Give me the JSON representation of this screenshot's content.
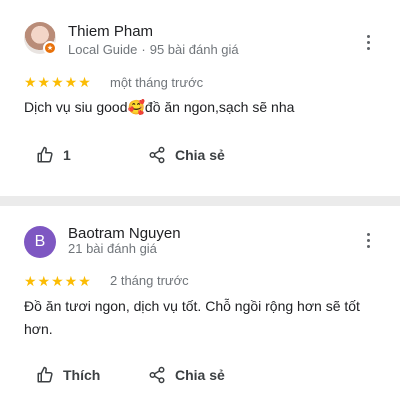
{
  "reviews": [
    {
      "name": "Thiem Pham",
      "role": "Local Guide",
      "review_count": "95 bài đánh giá",
      "stars": "★★★★★",
      "rating": 5,
      "time": "một tháng trước",
      "text": "Dịch vụ siu good🥰đồ ăn ngon,sạch sẽ nha",
      "like_label": "1",
      "share_label": "Chia sẻ"
    },
    {
      "name": "Baotram Nguyen",
      "avatar_letter": "B",
      "review_count": "21 bài đánh giá",
      "stars": "★★★★★",
      "rating": 5,
      "time": "2 tháng trước",
      "text": "Đồ ăn tươi ngon, dịch vụ tốt. Chỗ ngồi rộng hơn sẽ tốt hơn.",
      "like_label": "Thích",
      "share_label": "Chia sẻ"
    }
  ],
  "colors": {
    "star": "#fbbc04",
    "avatar_bg": "#7e57c2",
    "local_guide_badge": "#e8710a",
    "divider": "#ebebeb"
  },
  "icons": {
    "like": "thumbs-up-icon",
    "share": "share-icon",
    "more": "more-vertical-icon",
    "badge": "local-guide-badge-icon"
  }
}
